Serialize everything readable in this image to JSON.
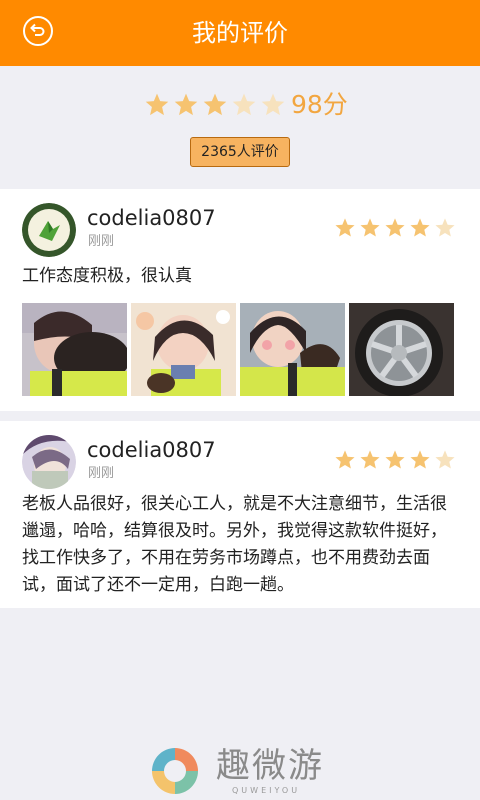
{
  "header": {
    "title": "我的评价",
    "back_icon": "back-arrow-icon"
  },
  "summary": {
    "rating": 3,
    "max_rating": 5,
    "score_text": "98分",
    "count_text": "2365人评价"
  },
  "colors": {
    "accent": "#ff8a00",
    "star_filled": "#f6c370",
    "star_empty": "#f7e2bd",
    "score": "#f2a640"
  },
  "reviews": [
    {
      "username": "codelia0807",
      "time": "刚刚",
      "rating": 4,
      "comment": "工作态度积极，很认真",
      "photos": [
        "photo-selfie-1",
        "photo-selfie-2",
        "photo-selfie-3",
        "photo-car-wheel"
      ]
    },
    {
      "username": "codelia0807",
      "time": "刚刚",
      "rating": 4,
      "comment": "老板人品很好，很关心工人，就是不大注意细节，生活很邋遢，哈哈，结算很及时。另外，我觉得这款软件挺好，找工作快多了，不用在劳务市场蹲点，也不用费劲去面试，面试了还不一定用，白跑一趟。",
      "photos": []
    }
  ],
  "footer": {
    "logo_text": "趣微游",
    "logo_sub": "QUWEIYOU"
  }
}
